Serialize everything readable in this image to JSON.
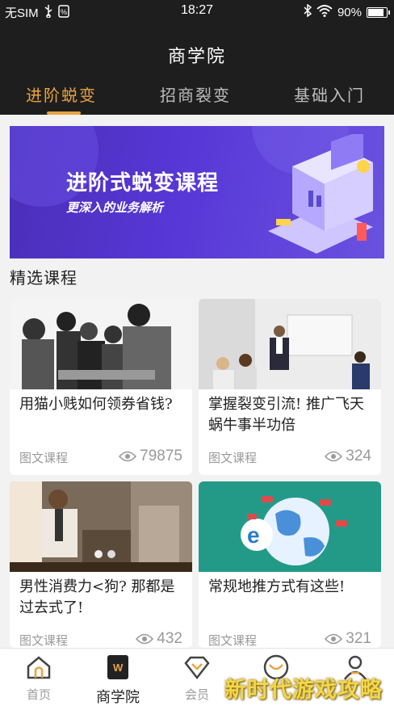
{
  "status": {
    "carrier": "无SIM",
    "time": "18:27",
    "battery": "90%",
    "battery_level": 0.9
  },
  "header": {
    "title": "商学院",
    "tabs": [
      {
        "label": "进阶蜕变",
        "active": true
      },
      {
        "label": "招商裂变",
        "active": false
      },
      {
        "label": "基础入门",
        "active": false
      }
    ]
  },
  "banner": {
    "title": "进阶式蜕变课程",
    "subtitle": "更深入的业务解析"
  },
  "section": {
    "title": "精选课程"
  },
  "courses": [
    {
      "title": "用猫小贱如何领券省钱?",
      "type": "图文课程",
      "views": "79875"
    },
    {
      "title": "掌握裂变引流! 推广飞天蜗牛事半功倍",
      "type": "图文课程",
      "views": "324"
    },
    {
      "title": "男性消费力<狗? 那都是过去式了!",
      "type": "图文课程",
      "views": "432"
    },
    {
      "title": "常规地推方式有这些!",
      "type": "图文课程",
      "views": "321"
    }
  ],
  "tabbar": {
    "items": [
      {
        "label": "首页",
        "icon": "home-icon"
      },
      {
        "label": "商学院",
        "icon": "academy-icon",
        "active": true
      },
      {
        "label": "会员",
        "icon": "member-diamond-icon"
      },
      {
        "label": "",
        "icon": "crown-icon"
      },
      {
        "label": "",
        "icon": "profile-icon"
      }
    ]
  },
  "watermark": "新时代游戏攻略",
  "colors": {
    "accent": "#e8a341",
    "header_bg": "#1e1e1e",
    "banner_bg": "#5737d6"
  }
}
